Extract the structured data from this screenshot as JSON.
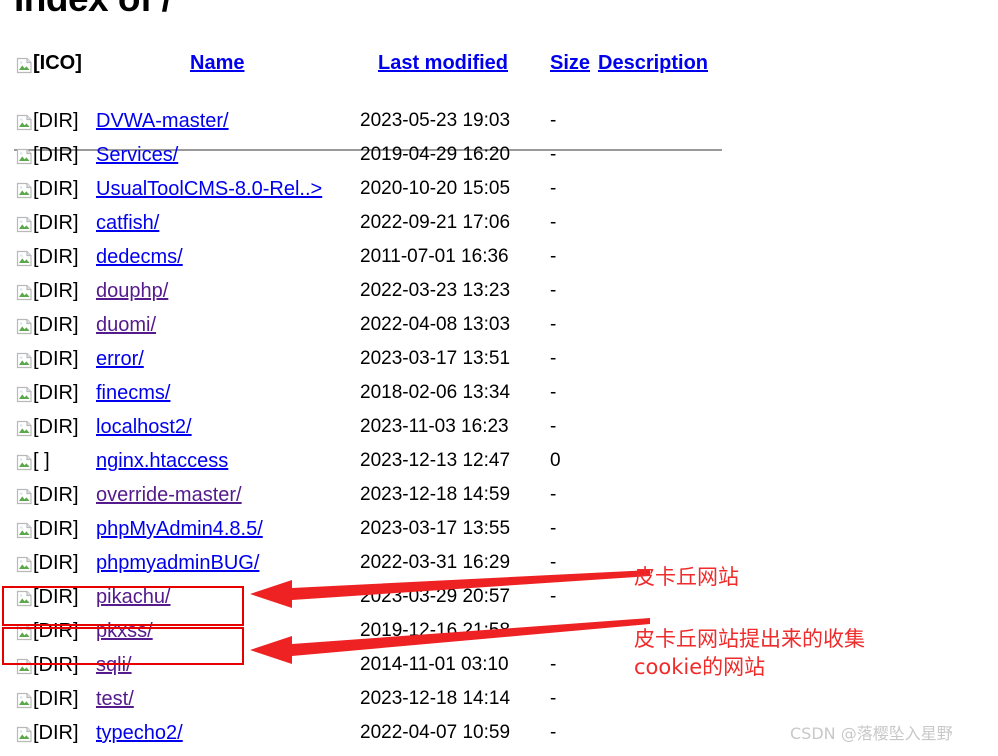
{
  "page": {
    "title": "Index of /",
    "watermark": "CSDN @落樱坠入星野"
  },
  "table": {
    "header": {
      "icon_label": "[ICO]",
      "name": "Name",
      "last_modified": "Last modified",
      "size": "Size",
      "description": "Description"
    },
    "rows": [
      {
        "flag": "[DIR]",
        "name": "DVWA-master/",
        "modified": "2023-05-23 19:03",
        "size": "-",
        "desc": "",
        "visited": false
      },
      {
        "flag": "[DIR]",
        "name": "Services/",
        "modified": "2019-04-29 16:20",
        "size": "-",
        "desc": "",
        "visited": false
      },
      {
        "flag": "[DIR]",
        "name": "UsualToolCMS-8.0-Rel..>",
        "modified": "2020-10-20 15:05",
        "size": "-",
        "desc": "",
        "visited": false
      },
      {
        "flag": "[DIR]",
        "name": "catfish/",
        "modified": "2022-09-21 17:06",
        "size": "-",
        "desc": "",
        "visited": false
      },
      {
        "flag": "[DIR]",
        "name": "dedecms/",
        "modified": "2011-07-01 16:36",
        "size": "-",
        "desc": "",
        "visited": false
      },
      {
        "flag": "[DIR]",
        "name": "douphp/",
        "modified": "2022-03-23 13:23",
        "size": "-",
        "desc": "",
        "visited": true
      },
      {
        "flag": "[DIR]",
        "name": "duomi/",
        "modified": "2022-04-08 13:03",
        "size": "-",
        "desc": "",
        "visited": true
      },
      {
        "flag": "[DIR]",
        "name": "error/",
        "modified": "2023-03-17 13:51",
        "size": "-",
        "desc": "",
        "visited": false
      },
      {
        "flag": "[DIR]",
        "name": "finecms/",
        "modified": "2018-02-06 13:34",
        "size": "-",
        "desc": "",
        "visited": false
      },
      {
        "flag": "[DIR]",
        "name": "localhost2/",
        "modified": "2023-11-03 16:23",
        "size": "-",
        "desc": "",
        "visited": false
      },
      {
        "flag": "[ ]",
        "name": "nginx.htaccess",
        "modified": "2023-12-13 12:47",
        "size": "0",
        "desc": "",
        "visited": false
      },
      {
        "flag": "[DIR]",
        "name": "override-master/",
        "modified": "2023-12-18 14:59",
        "size": "-",
        "desc": "",
        "visited": true
      },
      {
        "flag": "[DIR]",
        "name": "phpMyAdmin4.8.5/",
        "modified": "2023-03-17 13:55",
        "size": "-",
        "desc": "",
        "visited": false
      },
      {
        "flag": "[DIR]",
        "name": "phpmyadminBUG/",
        "modified": "2022-03-31 16:29",
        "size": "-",
        "desc": "",
        "visited": false
      },
      {
        "flag": "[DIR]",
        "name": "pikachu/",
        "modified": "2023-03-29 20:57",
        "size": "-",
        "desc": "",
        "visited": true
      },
      {
        "flag": "[DIR]",
        "name": "pkxss/",
        "modified": "2019-12-16 21:58",
        "size": "-",
        "desc": "",
        "visited": true
      },
      {
        "flag": "[DIR]",
        "name": "sqli/",
        "modified": "2014-11-01 03:10",
        "size": "-",
        "desc": "",
        "visited": true
      },
      {
        "flag": "[DIR]",
        "name": "test/",
        "modified": "2023-12-18 14:14",
        "size": "-",
        "desc": "",
        "visited": true
      },
      {
        "flag": "[DIR]",
        "name": "typecho2/",
        "modified": "2022-04-07 10:59",
        "size": "-",
        "desc": "",
        "visited": false
      }
    ]
  },
  "annotations": {
    "pikachu_note": "皮卡丘网站",
    "pkxss_note": "皮卡丘网站提出来的收集\ncookie的网站",
    "highlight_color": "#e60000",
    "text_color": "#ef2b2b"
  }
}
